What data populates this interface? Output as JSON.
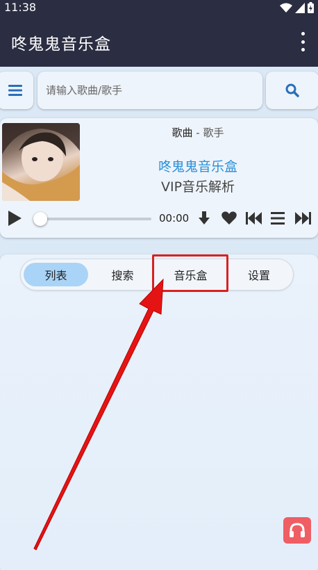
{
  "status_bar": {
    "time": "11:38"
  },
  "app_bar": {
    "title": "咚鬼鬼音乐盒"
  },
  "search": {
    "placeholder": "请输入歌曲/歌手"
  },
  "player": {
    "song": "歌曲",
    "separator": "-",
    "artist": "歌手",
    "name": "咚鬼鬼音乐盒",
    "subtitle": "VIP音乐解析",
    "time": "00:00",
    "progress": 0
  },
  "tabs": [
    {
      "label": "列表",
      "active": true
    },
    {
      "label": "搜索",
      "active": false
    },
    {
      "label": "音乐盒",
      "active": false
    },
    {
      "label": "设置",
      "active": false
    }
  ],
  "colors": {
    "app_bar": "#2b2d42",
    "accent": "#2a8fd6",
    "active_tab": "#a9d4f7",
    "highlight": "#d92020",
    "headphone_button": "#ef5e64"
  },
  "icons": [
    "wifi-icon",
    "signal-icon",
    "battery-icon",
    "more-vert-icon",
    "menu-icon",
    "search-icon",
    "play-icon",
    "download-icon",
    "heart-icon",
    "skip-previous-icon",
    "playlist-icon",
    "skip-next-icon",
    "headphones-icon"
  ]
}
